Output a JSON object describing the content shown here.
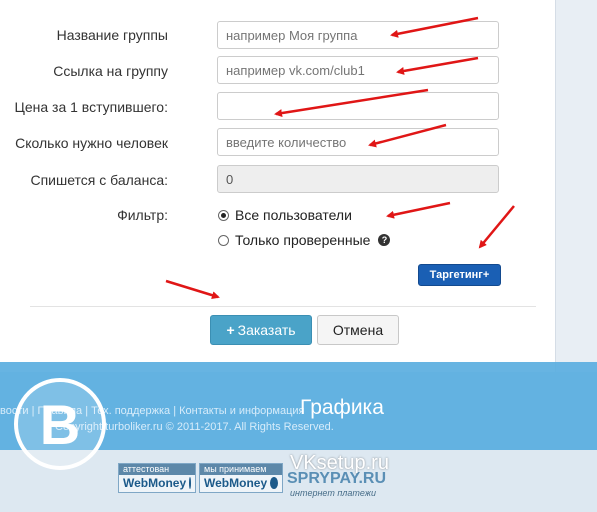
{
  "form": {
    "group_name": {
      "label": "Название группы",
      "placeholder": "например Моя группа"
    },
    "group_link": {
      "label": "Ссылка на группу",
      "placeholder": "например vk.com/club1"
    },
    "price": {
      "label": "Цена за 1 вступившего:",
      "value": ""
    },
    "count": {
      "label": "Сколько нужно человек",
      "placeholder": "введите количество"
    },
    "balance": {
      "label": "Спишется с баланса:",
      "value": "0"
    },
    "filter": {
      "label": "Фильтр:",
      "options": [
        "Все пользователи",
        "Только проверенные"
      ],
      "selected": "Все пользователи",
      "help_icon": "?"
    },
    "targeting_button": "Таргетинг+",
    "order_button": "Заказать",
    "order_icon": "+",
    "cancel_button": "Отмена"
  },
  "footer": {
    "links": "вости | Правила | Тех. поддержка | Контакты и информация",
    "copyright": "Copyright turboliker.ru © 2011-2017. All Rights Reserved.",
    "watermark_label": "Графика",
    "site": "VKsetup.ru",
    "logo_letter": "B",
    "badges": [
      {
        "top": "аттестован",
        "bottom": "WebMoney"
      },
      {
        "top": "мы принимаем",
        "bottom": "WebMoney"
      }
    ],
    "spry": "SPRYPAY.RU",
    "spry_sub": "интернет платежи"
  },
  "colors": {
    "arrow": "#e01616",
    "targeting": "#1a5fb4",
    "order": "#4aa3c8",
    "band": "#5aaee0"
  }
}
